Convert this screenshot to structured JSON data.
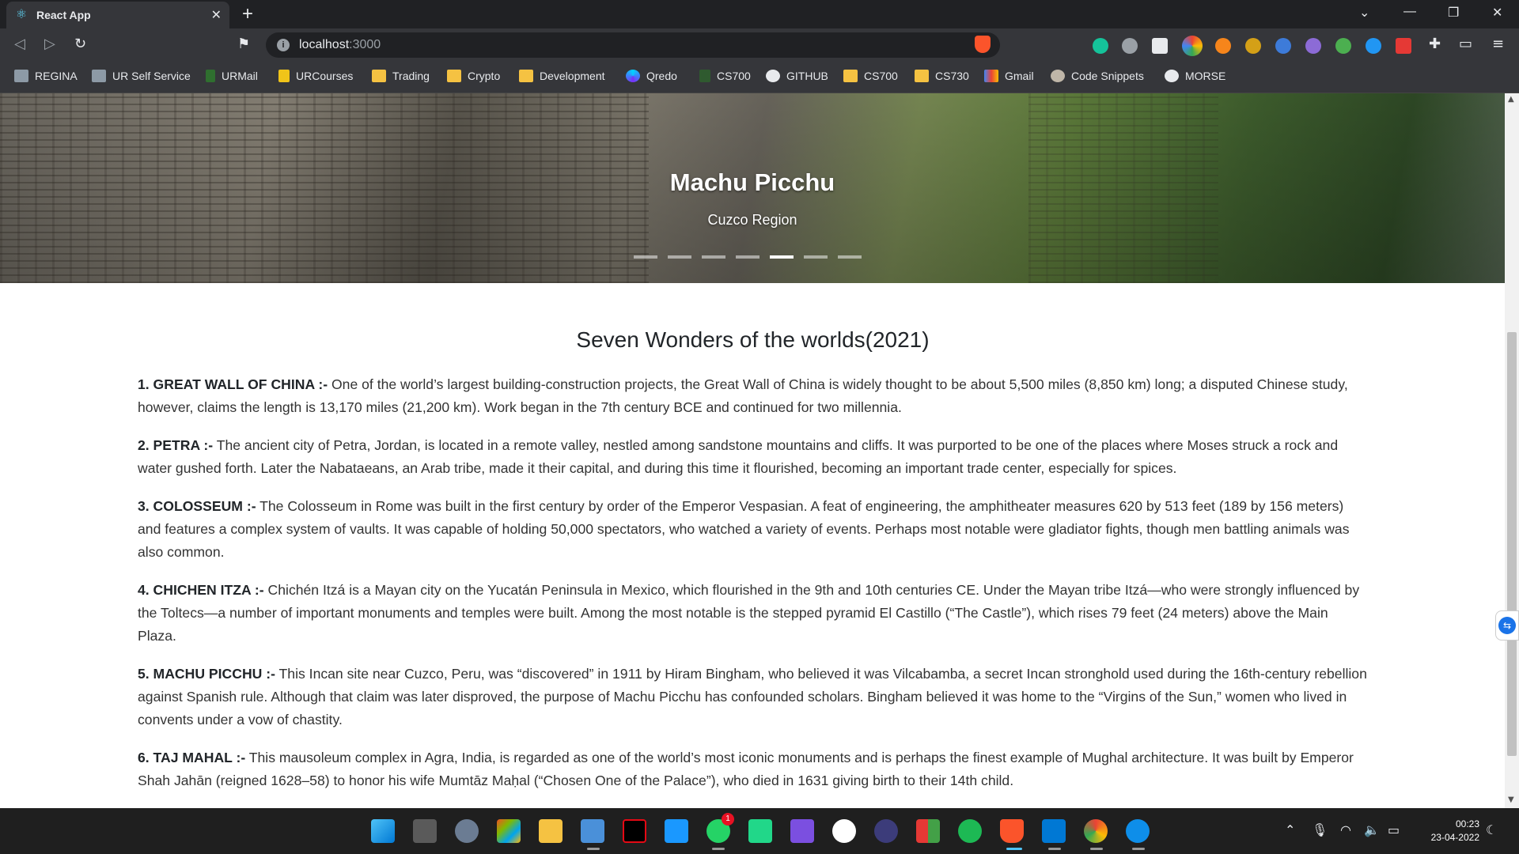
{
  "browser": {
    "tab_title": "React App",
    "new_tab": "+",
    "address": {
      "host": "localhost",
      "port": ":3000"
    },
    "window_controls": [
      "⌄",
      "—",
      "❐",
      "✕"
    ],
    "bookmarks": [
      {
        "label": "REGINA",
        "icon": "regina-icon"
      },
      {
        "label": "UR Self Service",
        "icon": "ur-self-service-icon"
      },
      {
        "label": "URMail",
        "icon": "urmail-icon"
      },
      {
        "label": "URCourses",
        "icon": "urcourses-icon"
      },
      {
        "label": "Trading",
        "icon": "folder-icon"
      },
      {
        "label": "Crypto",
        "icon": "folder-icon"
      },
      {
        "label": "Development",
        "icon": "folder-icon"
      },
      {
        "label": "Qredo",
        "icon": "qredo-icon"
      },
      {
        "label": "CS700",
        "icon": "cs700-icon"
      },
      {
        "label": "GITHUB",
        "icon": "github-icon"
      },
      {
        "label": "CS700",
        "icon": "folder-icon"
      },
      {
        "label": "CS730",
        "icon": "folder-icon"
      },
      {
        "label": "Gmail",
        "icon": "gmail-icon"
      },
      {
        "label": "Code Snippets",
        "icon": "code-snippets-icon"
      },
      {
        "label": "MORSE",
        "icon": "github-icon"
      }
    ]
  },
  "carousel": {
    "title": "Machu Picchu",
    "subtitle": "Cuzco Region",
    "slide_count": 7,
    "active_index": 4
  },
  "page": {
    "title": "Seven Wonders of the worlds(2021)",
    "wonders": [
      {
        "name": "1. GREAT WALL OF CHINA :-",
        "text": " One of the world’s largest building-construction projects, the Great Wall of China is widely thought to be about 5,500 miles (8,850 km) long; a disputed Chinese study, however, claims the length is 13,170 miles (21,200 km). Work began in the 7th century BCE and continued for two millennia."
      },
      {
        "name": "2. PETRA :-",
        "text": " The ancient city of Petra, Jordan, is located in a remote valley, nestled among sandstone mountains and cliffs. It was purported to be one of the places where Moses struck a rock and water gushed forth. Later the Nabataeans, an Arab tribe, made it their capital, and during this time it flourished, becoming an important trade center, especially for spices."
      },
      {
        "name": "3. COLOSSEUM :-",
        "text": " The Colosseum in Rome was built in the first century by order of the Emperor Vespasian. A feat of engineering, the amphitheater measures 620 by 513 feet (189 by 156 meters) and features a complex system of vaults. It was capable of holding 50,000 spectators, who watched a variety of events. Perhaps most notable were gladiator fights, though men battling animals was also common."
      },
      {
        "name": "4. CHICHEN ITZA :-",
        "text": " Chichén Itzá is a Mayan city on the Yucatán Peninsula in Mexico, which flourished in the 9th and 10th centuries CE. Under the Mayan tribe Itzá—who were strongly influenced by the Toltecs—a number of important monuments and temples were built. Among the most notable is the stepped pyramid El Castillo (“The Castle”), which rises 79 feet (24 meters) above the Main Plaza."
      },
      {
        "name": "5. MACHU PICCHU :-",
        "text": " This Incan site near Cuzco, Peru, was “discovered” in 1911 by Hiram Bingham, who believed it was Vilcabamba, a secret Incan stronghold used during the 16th-century rebellion against Spanish rule. Although that claim was later disproved, the purpose of Machu Picchu has confounded scholars. Bingham believed it was home to the “Virgins of the Sun,” women who lived in convents under a vow of chastity."
      },
      {
        "name": "6. TAJ MAHAL :-",
        "text": " This mausoleum complex in Agra, India, is regarded as one of the world’s most iconic monuments and is perhaps the finest example of Mughal architecture. It was built by Emperor Shah Jahān (reigned 1628–58) to honor his wife Mumtāz Maḥal (“Chosen One of the Palace”), who died in 1631 giving birth to their 14th child."
      }
    ]
  },
  "taskbar": {
    "whatsapp_badge": "1",
    "time": "00:23",
    "date": "23-04-2022"
  }
}
